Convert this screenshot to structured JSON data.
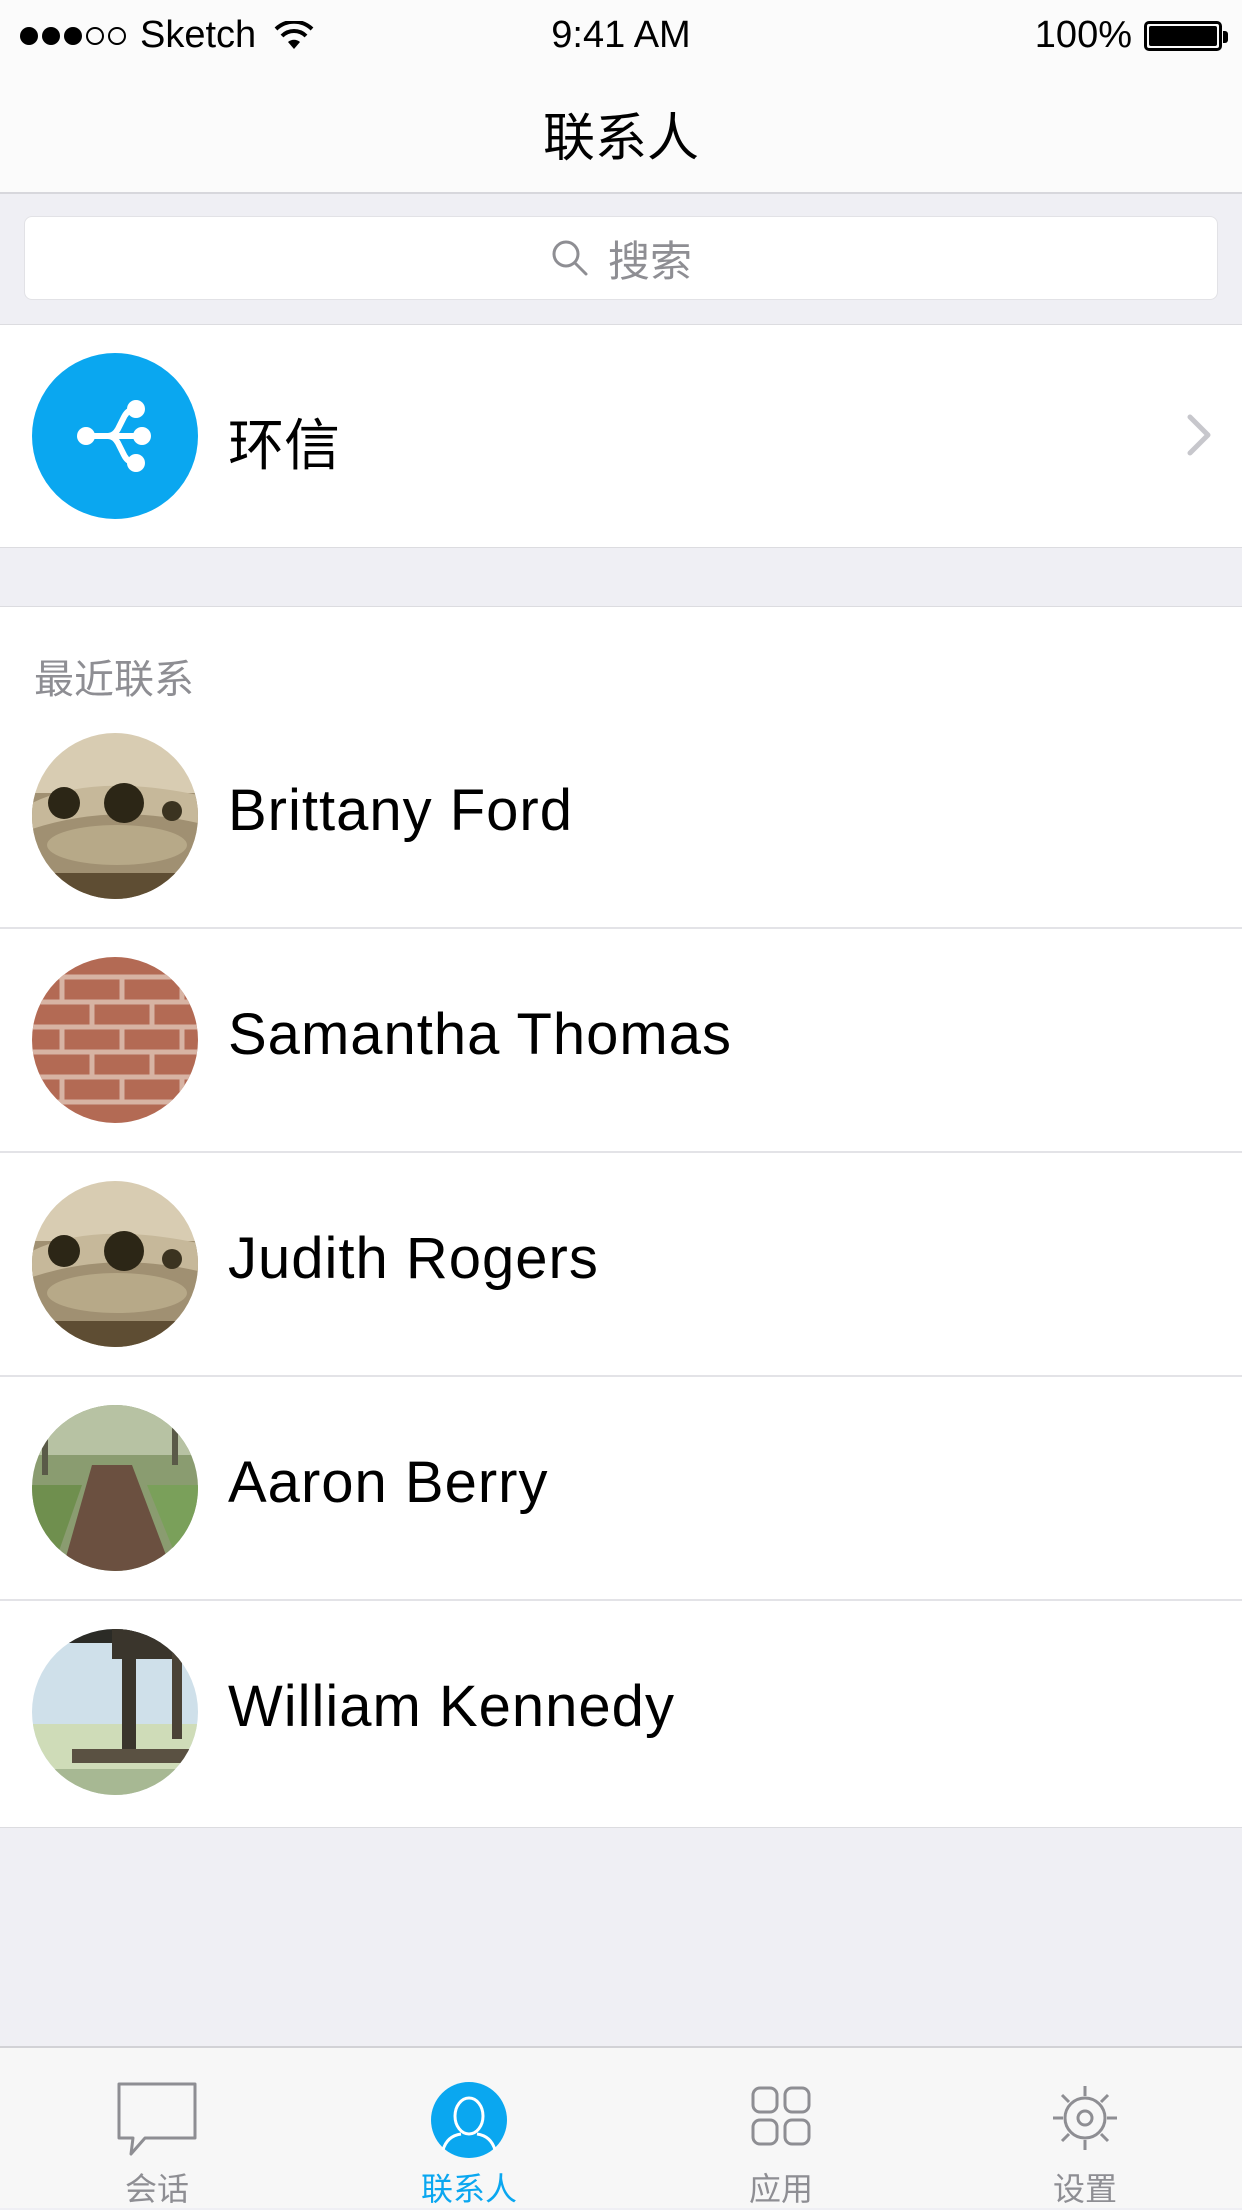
{
  "status_bar": {
    "carrier": "Sketch",
    "time": "9:41 AM",
    "battery": "100%"
  },
  "nav": {
    "title": "联系人"
  },
  "search": {
    "placeholder": "搜索"
  },
  "service": {
    "name": "环信",
    "icon": "share-network-icon",
    "color": "#0aa7f0"
  },
  "recent": {
    "header": "最近联系",
    "contacts": [
      {
        "name": "Brittany Ford",
        "avatar": "landscape-trees-photo"
      },
      {
        "name": "Samantha Thomas",
        "avatar": "brick-wall-photo"
      },
      {
        "name": "Judith Rogers",
        "avatar": "landscape-trees-photo"
      },
      {
        "name": "Aaron Berry",
        "avatar": "forest-path-photo"
      },
      {
        "name": "William Kennedy",
        "avatar": "pier-lake-photo"
      }
    ]
  },
  "tabs": [
    {
      "label": "会话",
      "icon": "chat-bubble-icon",
      "active": false
    },
    {
      "label": "联系人",
      "icon": "person-icon",
      "active": true
    },
    {
      "label": "应用",
      "icon": "apps-grid-icon",
      "active": false
    },
    {
      "label": "设置",
      "icon": "gear-icon",
      "active": false
    }
  ],
  "colors": {
    "accent": "#0aa7f0",
    "inactive": "#8e8e93",
    "background": "#efeff4"
  }
}
